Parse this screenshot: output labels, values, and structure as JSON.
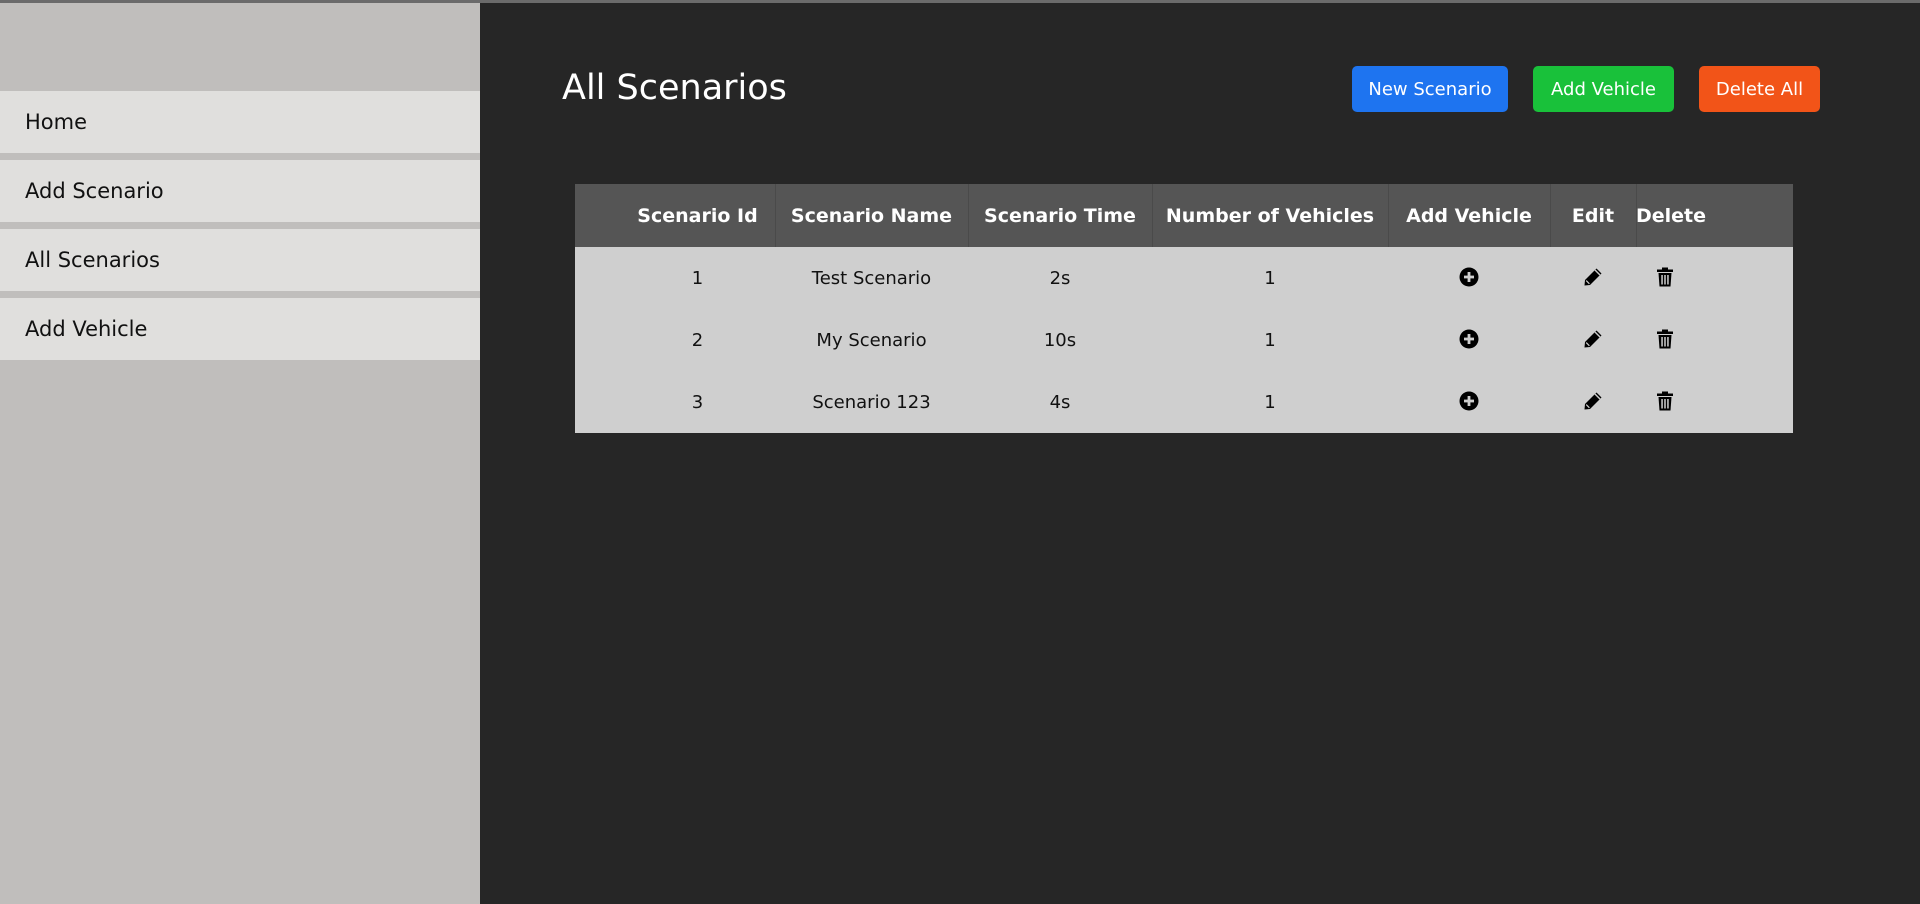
{
  "sidebar": {
    "items": [
      {
        "label": "Home"
      },
      {
        "label": "Add Scenario"
      },
      {
        "label": "All Scenarios"
      },
      {
        "label": "Add Vehicle"
      }
    ]
  },
  "page": {
    "title": "All Scenarios"
  },
  "toolbar": {
    "new_scenario_label": "New Scenario",
    "add_vehicle_label": "Add Vehicle",
    "delete_all_label": "Delete All"
  },
  "table": {
    "headers": [
      "Scenario Id",
      "Scenario Name",
      "Scenario Time",
      "Number of Vehicles",
      "Add Vehicle",
      "Edit",
      "Delete"
    ],
    "rows": [
      {
        "id": "1",
        "name": "Test Scenario",
        "time": "2s",
        "vehicles": "1"
      },
      {
        "id": "2",
        "name": "My Scenario",
        "time": "10s",
        "vehicles": "1"
      },
      {
        "id": "3",
        "name": "Scenario 123",
        "time": "4s",
        "vehicles": "1"
      }
    ],
    "row_icons": {
      "add": "plus-circle-icon",
      "edit": "pencil-icon",
      "delete": "trash-icon"
    }
  },
  "colors": {
    "new_scenario": "#1e74f0",
    "add_vehicle": "#19c13a",
    "delete_all": "#f25418",
    "background": "#262626",
    "sidebar": "#c0bebc"
  }
}
